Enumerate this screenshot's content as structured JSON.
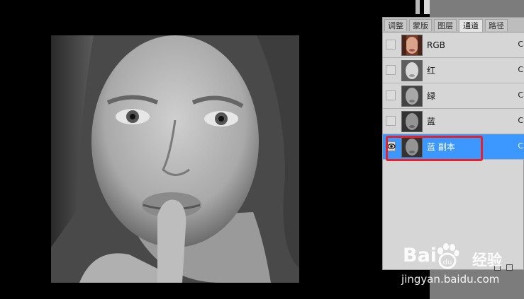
{
  "panel": {
    "tabs": [
      {
        "label": "调整",
        "active": false
      },
      {
        "label": "蒙版",
        "active": false
      },
      {
        "label": "图层",
        "active": false
      },
      {
        "label": "通道",
        "active": true
      },
      {
        "label": "路径",
        "active": false
      }
    ],
    "channels": [
      {
        "label": "RGB",
        "visible": false,
        "selected": false,
        "thumb": "color"
      },
      {
        "label": "红",
        "visible": false,
        "selected": false,
        "thumb": "gray"
      },
      {
        "label": "绿",
        "visible": false,
        "selected": false,
        "thumb": "gray"
      },
      {
        "label": "蓝",
        "visible": false,
        "selected": false,
        "thumb": "gray"
      },
      {
        "label": "蓝 副本",
        "visible": true,
        "selected": true,
        "thumb": "gray"
      }
    ],
    "shortcut_glyph": "C",
    "eye_glyph": "👁"
  },
  "watermark": {
    "logo": "Bai",
    "logo_suffix": "du",
    "chinese": "经验",
    "url": "jingyan.baidu.com"
  },
  "colors": {
    "selection": "#3c97ff",
    "annotation": "#e8202a",
    "panel_bg": "#d6d6d6"
  }
}
